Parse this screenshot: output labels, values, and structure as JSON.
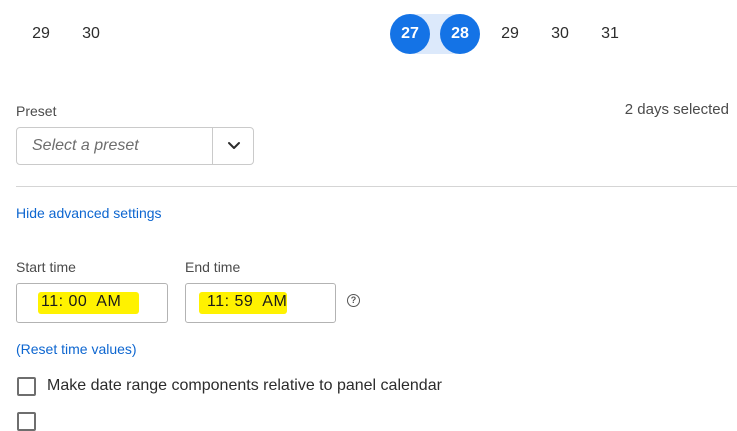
{
  "calendar": {
    "left_days": [
      "29",
      "30"
    ],
    "right_days": [
      {
        "label": "27",
        "selected": true
      },
      {
        "label": "28",
        "selected": true
      },
      {
        "label": "29",
        "selected": false
      },
      {
        "label": "30",
        "selected": false
      },
      {
        "label": "31",
        "selected": false
      }
    ],
    "selection_color": "#1473e6",
    "range_color": "#dce9fb"
  },
  "preset": {
    "label": "Preset",
    "placeholder": "Select a preset",
    "selected_count_text": "2 days selected",
    "dropdown_icon": "chevron-down-icon"
  },
  "advanced": {
    "toggle_link": "Hide advanced settings",
    "start_time_label": "Start time",
    "start_time_value": "11: 00  AM",
    "end_time_label": "End time",
    "end_time_value": "11: 59  AM",
    "help_icon": "help-circle-icon",
    "help_glyph": "?",
    "reset_link": "(Reset time values)",
    "highlight_color": "#fff200"
  },
  "options": [
    {
      "label": "Make date range components relative to panel calendar",
      "checked": false
    }
  ],
  "link_color": "#0d66d0"
}
